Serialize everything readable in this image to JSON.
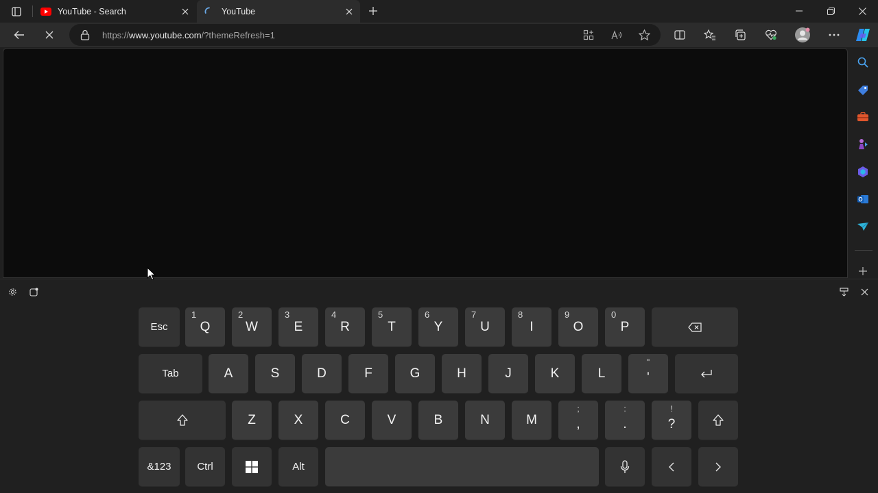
{
  "browser": {
    "tabs": [
      {
        "title": "YouTube - Search",
        "favicon": "youtube-icon",
        "active": false
      },
      {
        "title": "YouTube",
        "favicon": "loading-spinner-icon",
        "active": true
      }
    ],
    "address": {
      "prefix": "https://",
      "host": "www.youtube.com",
      "path": "/?themeRefresh=1"
    },
    "toolbar_icons": [
      "back-icon",
      "stop-loading-icon",
      "lock-icon",
      "app-available-icon",
      "read-aloud-icon",
      "favorite-star-icon",
      "split-screen-icon",
      "favorites-icon",
      "collections-icon",
      "browser-essentials-icon",
      "profile-avatar",
      "more-icon",
      "copilot-icon"
    ],
    "sidebar_icons": [
      "search-icon",
      "shopping-icon",
      "tools-icon",
      "games-icon",
      "m365-icon",
      "outlook-icon",
      "drop-icon",
      "add-icon"
    ]
  },
  "keyboard": {
    "rows": [
      [
        {
          "label": "Esc",
          "type": "fn"
        },
        {
          "label": "Q",
          "hint": "1"
        },
        {
          "label": "W",
          "hint": "2"
        },
        {
          "label": "E",
          "hint": "3"
        },
        {
          "label": "R",
          "hint": "4"
        },
        {
          "label": "T",
          "hint": "5"
        },
        {
          "label": "Y",
          "hint": "6"
        },
        {
          "label": "U",
          "hint": "7"
        },
        {
          "label": "I",
          "hint": "8"
        },
        {
          "label": "O",
          "hint": "9"
        },
        {
          "label": "P",
          "hint": "0"
        },
        {
          "label": "",
          "type": "fn",
          "icon": "backspace-icon"
        }
      ],
      [
        {
          "label": "Tab",
          "type": "fn"
        },
        {
          "label": "A"
        },
        {
          "label": "S"
        },
        {
          "label": "D"
        },
        {
          "label": "F"
        },
        {
          "label": "G"
        },
        {
          "label": "H"
        },
        {
          "label": "J"
        },
        {
          "label": "K"
        },
        {
          "label": "L"
        },
        {
          "label": "'",
          "shift": "\""
        },
        {
          "label": "",
          "type": "fn",
          "icon": "enter-icon"
        }
      ],
      [
        {
          "label": "",
          "type": "fn",
          "icon": "shift-icon"
        },
        {
          "label": "Z"
        },
        {
          "label": "X"
        },
        {
          "label": "C"
        },
        {
          "label": "V"
        },
        {
          "label": "B"
        },
        {
          "label": "N"
        },
        {
          "label": "M"
        },
        {
          "label": ",",
          "shift": ";"
        },
        {
          "label": ".",
          "shift": ":"
        },
        {
          "label": "?",
          "shift": "!"
        },
        {
          "label": "",
          "type": "fn",
          "icon": "shift-icon"
        }
      ],
      [
        {
          "label": "&123",
          "type": "fn"
        },
        {
          "label": "Ctrl",
          "type": "fn"
        },
        {
          "label": "",
          "type": "fn",
          "icon": "windows-logo-icon"
        },
        {
          "label": "Alt",
          "type": "fn"
        },
        {
          "label": "",
          "icon": "space-bar"
        },
        {
          "label": "",
          "type": "fn",
          "icon": "microphone-icon"
        },
        {
          "label": "",
          "type": "fn",
          "icon": "arrow-left-icon"
        },
        {
          "label": "",
          "type": "fn",
          "icon": "arrow-right-icon"
        }
      ]
    ]
  }
}
